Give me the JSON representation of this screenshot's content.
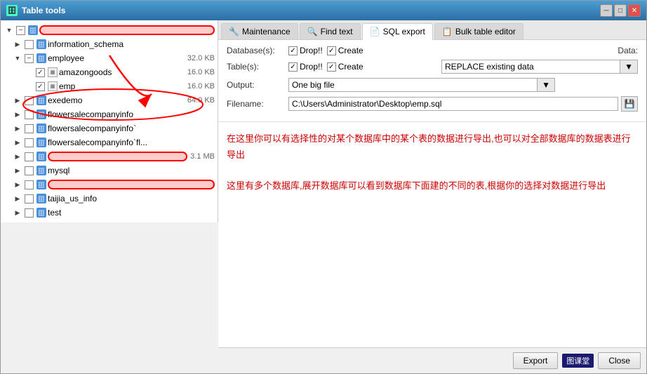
{
  "window": {
    "title": "Table tools",
    "controls": [
      "minimize",
      "maximize",
      "close"
    ]
  },
  "tabs": [
    {
      "id": "maintenance",
      "label": "Maintenance",
      "icon": "🔧",
      "active": false
    },
    {
      "id": "findtext",
      "label": "Find text",
      "icon": "🔍",
      "active": false
    },
    {
      "id": "sqlexport",
      "label": "SQL export",
      "icon": "📄",
      "active": true
    },
    {
      "id": "bulktable",
      "label": "Bulk table editor",
      "icon": "📋",
      "active": false
    }
  ],
  "form": {
    "databases_label": "Database(s):",
    "tables_label": "Table(s):",
    "output_label": "Output:",
    "filename_label": "Filename:",
    "data_label": "Data:",
    "drop_checked": true,
    "create_checked": true,
    "tables_drop_checked": true,
    "tables_create_checked": true,
    "data_value": "REPLACE existing data",
    "output_value": "One big file",
    "filename_value": "C:\\Users\\Administrator\\Desktop\\emp.sql"
  },
  "tree": {
    "items": [
      {
        "id": "root",
        "label": "",
        "level": 0,
        "expanded": true,
        "checked": "indeterminate",
        "type": "root"
      },
      {
        "id": "information_schema",
        "label": "information_schema",
        "level": 1,
        "expanded": false,
        "checked": "none",
        "type": "db"
      },
      {
        "id": "employee",
        "label": "employee",
        "level": 1,
        "expanded": true,
        "checked": "indeterminate",
        "size": "32.0 KB",
        "type": "db"
      },
      {
        "id": "amazongoods",
        "label": "amazongoods",
        "level": 2,
        "expanded": false,
        "checked": "checked",
        "size": "16.0 KB",
        "type": "table"
      },
      {
        "id": "emp",
        "label": "emp",
        "level": 2,
        "expanded": false,
        "checked": "checked",
        "size": "16.0 KB",
        "type": "table"
      },
      {
        "id": "exedemo",
        "label": "exedemo",
        "level": 1,
        "expanded": false,
        "checked": "none",
        "size": "64.0 KB",
        "type": "db"
      },
      {
        "id": "flowersalecompanyinfo",
        "label": "flowersalecompanyinfo",
        "level": 1,
        "expanded": false,
        "checked": "none",
        "type": "db"
      },
      {
        "id": "flowersalecompanyinfo2",
        "label": "flowersalecompanyinfo`",
        "level": 1,
        "expanded": false,
        "checked": "none",
        "type": "db"
      },
      {
        "id": "flowersalecompanyinfofl",
        "label": "flowersalecompanyinfo`fl...",
        "level": 1,
        "expanded": false,
        "checked": "none",
        "type": "db"
      },
      {
        "id": "reddb1",
        "label": "",
        "level": 1,
        "expanded": false,
        "checked": "none",
        "size": "3.1 MB",
        "type": "db",
        "redoval": true
      },
      {
        "id": "mysql",
        "label": "mysql",
        "level": 1,
        "expanded": false,
        "checked": "none",
        "type": "db"
      },
      {
        "id": "reddb2",
        "label": "",
        "level": 1,
        "expanded": false,
        "checked": "none",
        "type": "db",
        "redoval": true
      },
      {
        "id": "taijia_us_info",
        "label": "taijia_us_info",
        "level": 1,
        "expanded": false,
        "checked": "none",
        "type": "db"
      },
      {
        "id": "test",
        "label": "test",
        "level": 1,
        "expanded": false,
        "checked": "none",
        "type": "db"
      }
    ]
  },
  "content": {
    "paragraph1": "在这里你可以有选择性的对某个数据库中的某个表的数据进行导出,也可以对全部数据库的数据表进行导出",
    "paragraph2": "这里有多个数据库,展开数据库可以看到数据库下面建的不同的表,根据你的选择对数据进行导出"
  },
  "bottom": {
    "export_label": "Export",
    "close_label": "Close",
    "watermark": "图课堂"
  }
}
